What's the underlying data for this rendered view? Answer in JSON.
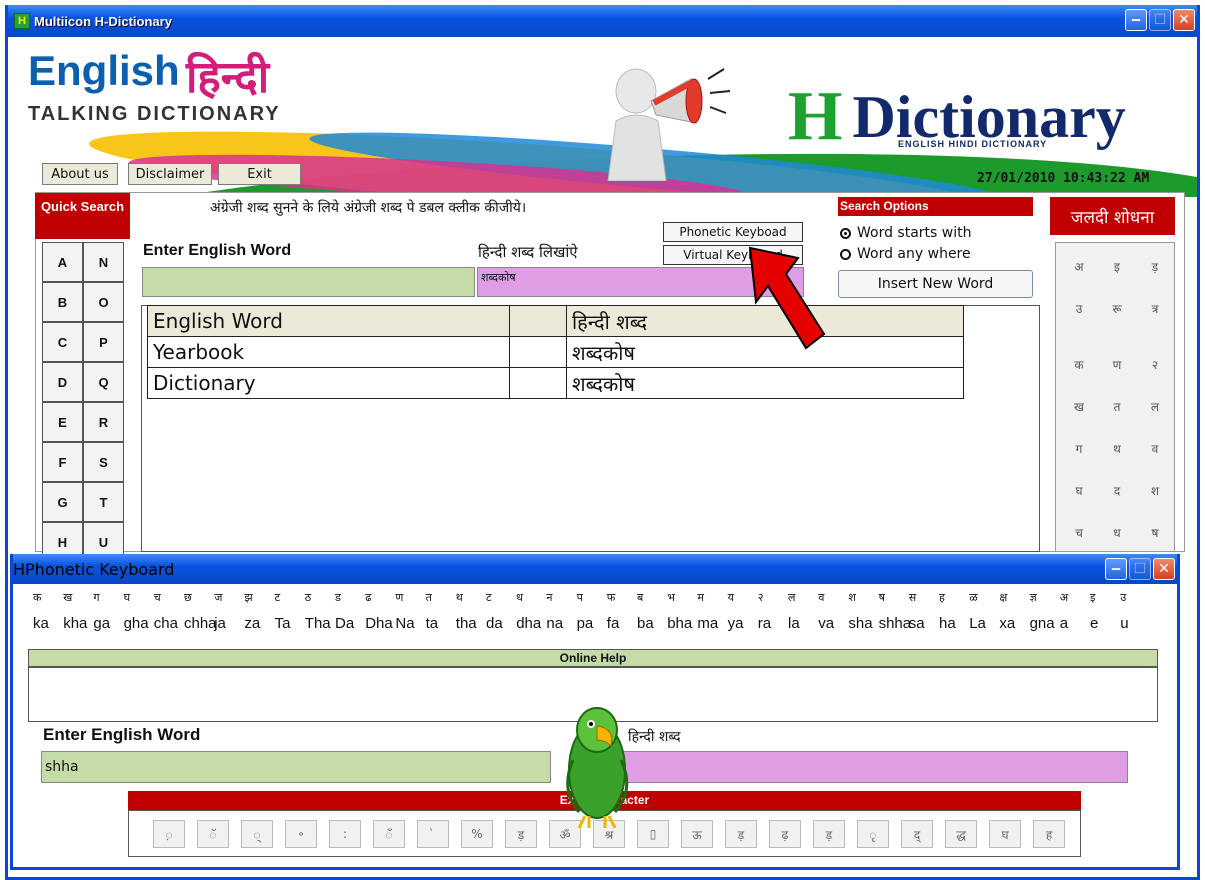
{
  "window": {
    "title": "Multiicon H-Dictionary",
    "icon": "H"
  },
  "banner": {
    "english": "English",
    "hindi": "हिन्दी",
    "subtitle": "TALKING DICTIONARY",
    "h_logo_letter": "H",
    "h_logo_word": "Dictionary",
    "h_logo_sub": "ENGLISH HINDI DICTIONARY"
  },
  "menu": {
    "about": "About us",
    "disclaimer": "Disclaimer",
    "exit": "Exit"
  },
  "datetime": "27/01/2010  10:43:22 AM",
  "instruction": "अंग्रेजी शब्द सुनने के लिये अंग्रेजी शब्द पे डबल क्लीक कीजीये।",
  "quick_search": {
    "title": "Quick Search",
    "letters": [
      "A",
      "N",
      "B",
      "O",
      "C",
      "P",
      "D",
      "Q",
      "E",
      "R",
      "F",
      "S",
      "G",
      "T",
      "H",
      "U"
    ]
  },
  "search": {
    "english_label": "Enter English Word",
    "hindi_label": "हिन्दी शब्द लिखांऐ",
    "english_value": "",
    "hindi_value": "शब्दकोष",
    "phonetic_button": "Phonetic Keyboad",
    "virtual_button": "Virtual Keyboard"
  },
  "search_options": {
    "title": "Search Options",
    "opt1": "Word starts with",
    "opt2": "Word any where",
    "selected": "Word starts with",
    "insert_button": "Insert New Word"
  },
  "results": {
    "header_en": "English Word",
    "header_hi": "हिन्दी शब्द",
    "rows": [
      {
        "en": "Yearbook",
        "hi": "शब्दकोष"
      },
      {
        "en": "Dictionary",
        "hi": "शब्दकोष"
      }
    ]
  },
  "jaldi": {
    "title": "जलदी शोधना",
    "keys": [
      "अ",
      "इ",
      "ड़",
      "उ",
      "रू",
      "त्र",
      "क",
      "ण",
      "२",
      "ख",
      "त",
      "ल",
      "ग",
      "थ",
      "व",
      "घ",
      "द",
      "श",
      "च",
      "ध",
      "ष"
    ]
  },
  "phonetic": {
    "title": "Phonetic Keyboard",
    "hindi_chars": [
      "क",
      "ख",
      "ग",
      "घ",
      "च",
      "छ",
      "ज",
      "झ",
      "ट",
      "ठ",
      "ड",
      "ढ",
      "ण",
      "त",
      "थ",
      "ट",
      "ध",
      "न",
      "प",
      "फ",
      "ब",
      "भ",
      "म",
      "य",
      "२",
      "ल",
      "व",
      "श",
      "ष",
      "स",
      "ह",
      "ळ",
      "क्ष",
      "ज्ञ",
      "अ",
      "इ",
      "उ"
    ],
    "english_chars": [
      "ka",
      "kha",
      "ga",
      "gha",
      "cha",
      "chha",
      "ja",
      "za",
      "Ta",
      "Tha",
      "Da",
      "Dha",
      "Na",
      "ta",
      "tha",
      "da",
      "dha",
      "na",
      "pa",
      "fa",
      "ba",
      "bha",
      "ma",
      "ya",
      "ra",
      "la",
      "va",
      "sha",
      "shha",
      "sa",
      "ha",
      "La",
      "xa",
      "gna",
      "a",
      "e",
      "u"
    ],
    "help_title": "Online Help",
    "english_label": "Enter English Word",
    "hindi_label": "हिन्दी शब्द",
    "english_value": "shha",
    "hindi_value": "",
    "extra_title": "Extra Character",
    "extra_keys": [
      "़",
      "ॅ",
      "्",
      "॰",
      ":",
      "ँ",
      "॓",
      "%",
      "ड़",
      "ॐ",
      "श्र",
      "▯",
      "ऊ",
      "ड़",
      "ढ़",
      "ड़",
      "ृ",
      "द्",
      "द्ध",
      "घ",
      "ह"
    ]
  }
}
